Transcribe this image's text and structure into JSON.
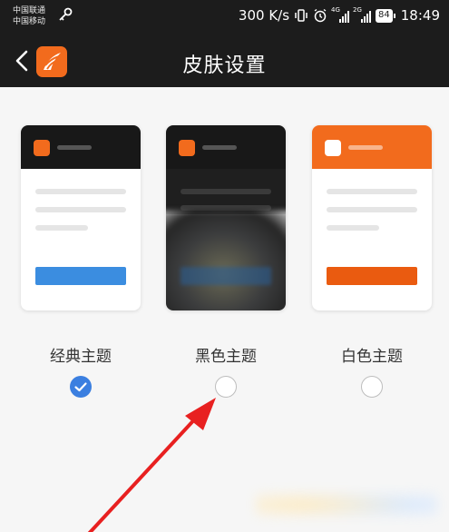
{
  "status_bar": {
    "carrier_1": "中国联通",
    "carrier_2": "中国移动",
    "speed": "300 K/s",
    "signal_tag_1": "4G",
    "signal_tag_2": "2G",
    "battery": "84",
    "time": "18:49",
    "icons": [
      "key-icon",
      "vibrate-icon",
      "alarm-icon",
      "signal-icon",
      "signal-icon",
      "battery-icon"
    ]
  },
  "header": {
    "title": "皮肤设置",
    "back_icon": "chevron-left-icon",
    "logo_icon": "app-logo-icon"
  },
  "themes": [
    {
      "label": "经典主题",
      "selected": true
    },
    {
      "label": "黑色主题",
      "selected": false
    },
    {
      "label": "白色主题",
      "selected": false
    }
  ],
  "colors": {
    "status_bar_bg": "#1c1c1c",
    "brand_orange": "#f26b1d",
    "accent_blue": "#3b7fe0",
    "classic_button": "#3b8de0",
    "white_theme_button": "#ea5b10",
    "annotation_arrow": "#e82020"
  }
}
